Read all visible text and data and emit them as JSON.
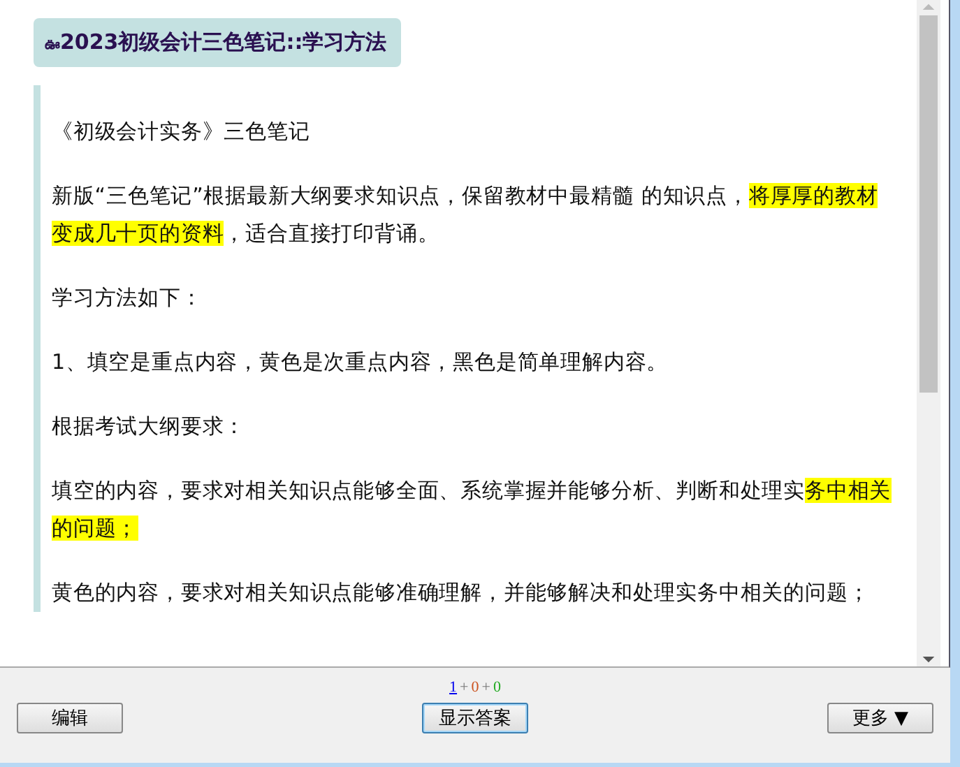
{
  "title": {
    "icon": "ఊ",
    "text": "2023初级会计三色笔记::学习方法"
  },
  "paragraphs": [
    [
      {
        "text": "《初级会计实务》三色笔记",
        "highlight": false
      }
    ],
    [
      {
        "text": "新版“三色笔记”根据最新大纲要求知识点，保留教材中最精髓 的知识点，",
        "highlight": false
      },
      {
        "text": "将厚厚的教材变成几十页的资料",
        "highlight": true
      },
      {
        "text": "，适合直接打印背诵。",
        "highlight": false
      }
    ],
    [
      {
        "text": "学习方法如下：",
        "highlight": false
      }
    ],
    [
      {
        "text": "1、填空是重点内容，黄色是次重点内容，黑色是简单理解内容。",
        "highlight": false
      }
    ],
    [
      {
        "text": "根据考试大纲要求：",
        "highlight": false
      }
    ],
    [
      {
        "text": "填空的内容，要求对相关知识点能够全面、系统掌握并能够分析、判断和处理实",
        "highlight": false
      },
      {
        "text": "务中相关的问题；",
        "highlight": true
      }
    ],
    [
      {
        "text": "黄色的内容，要求对相关知识点能够准确理解，并能够解决和处理实务中相关的问题；",
        "highlight": false
      }
    ]
  ],
  "counts": [
    {
      "text": "1",
      "color": "#0000ee",
      "link": true
    },
    {
      "text": "+",
      "link": false
    },
    {
      "text": "0",
      "color": "#cc5522",
      "link": false
    },
    {
      "text": "+",
      "link": false
    },
    {
      "text": "0",
      "color": "#22aa22",
      "link": false
    }
  ],
  "buttons": {
    "edit": "编辑",
    "show_answer": "显示答案",
    "more": "更多 ▼"
  }
}
